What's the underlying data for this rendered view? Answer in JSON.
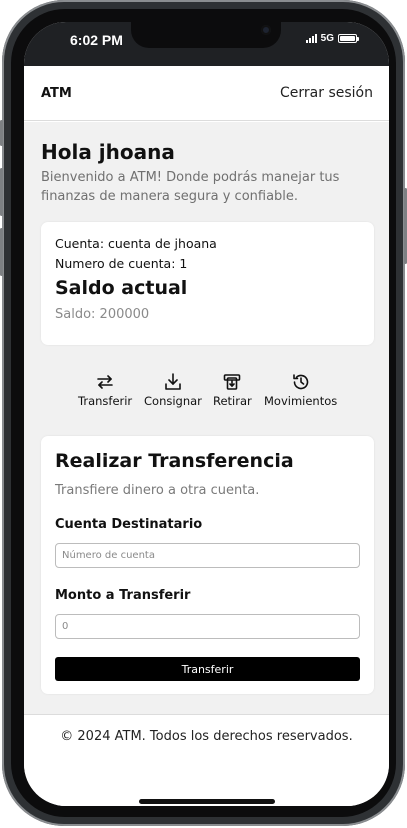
{
  "status_bar": {
    "time": "6:02 PM",
    "network": "5G"
  },
  "header": {
    "brand": "ATM",
    "logout_label": "Cerrar sesión"
  },
  "greeting": {
    "title": "Hola jhoana",
    "message": "Bienvenido a ATM! Donde podrás manejar tus finanzas de manera segura y confiable."
  },
  "account": {
    "account_line": "Cuenta: cuenta de jhoana",
    "number_line": "Numero de cuenta: 1",
    "balance_title": "Saldo actual",
    "balance_line": "Saldo: 200000"
  },
  "actions": [
    {
      "label": "Transferir",
      "icon": "transfer-arrows-icon"
    },
    {
      "label": "Consignar",
      "icon": "download-tray-icon"
    },
    {
      "label": "Retirar",
      "icon": "atm-withdraw-icon"
    },
    {
      "label": "Movimientos",
      "icon": "history-clock-icon"
    }
  ],
  "transfer": {
    "title": "Realizar Transferencia",
    "subtitle": "Transfiere dinero a otra cuenta.",
    "dest_label": "Cuenta Destinatario",
    "dest_placeholder": "Número de cuenta",
    "amount_label": "Monto a Transferir",
    "amount_placeholder": "0",
    "submit_label": "Transferir"
  },
  "footer": {
    "text": "© 2024 ATM. Todos los derechos reservados."
  },
  "colors": {
    "page_background": "#f1f1f1",
    "card_background": "#ffffff",
    "primary_button": "#000000",
    "muted_text": "#707070"
  }
}
